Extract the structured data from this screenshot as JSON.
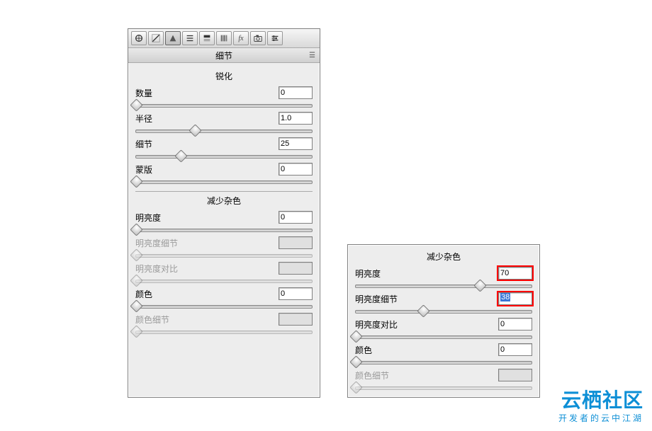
{
  "panel1": {
    "tab_label": "细节",
    "toolbar_icons": [
      "aperture",
      "adjust",
      "detail",
      "curves",
      "split",
      "hsl",
      "fx",
      "camera",
      "presets"
    ],
    "sharpen": {
      "title": "锐化",
      "rows": [
        {
          "label": "数量",
          "value": "0",
          "thumb": 0
        },
        {
          "label": "半径",
          "value": "1.0",
          "thumb": 33
        },
        {
          "label": "细节",
          "value": "25",
          "thumb": 25
        },
        {
          "label": "蒙版",
          "value": "0",
          "thumb": 0
        }
      ]
    },
    "noise": {
      "title": "减少杂色",
      "rows": [
        {
          "label": "明亮度",
          "value": "0",
          "thumb": 0,
          "disabled": false
        },
        {
          "label": "明亮度细节",
          "value": "",
          "thumb": 0,
          "disabled": true
        },
        {
          "label": "明亮度对比",
          "value": "",
          "thumb": 0,
          "disabled": true
        },
        {
          "label": "颜色",
          "value": "0",
          "thumb": 0,
          "disabled": false
        },
        {
          "label": "颜色细节",
          "value": "",
          "thumb": 0,
          "disabled": true
        }
      ]
    }
  },
  "panel2": {
    "title": "减少杂色",
    "rows": [
      {
        "label": "明亮度",
        "value": "70",
        "thumb": 70,
        "hl": true,
        "disabled": false
      },
      {
        "label": "明亮度细节",
        "value": "38",
        "thumb": 38,
        "hl": true,
        "sel": true,
        "disabled": false
      },
      {
        "label": "明亮度对比",
        "value": "0",
        "thumb": 0,
        "disabled": false
      },
      {
        "label": "颜色",
        "value": "0",
        "thumb": 0,
        "disabled": false
      },
      {
        "label": "颜色细节",
        "value": "",
        "thumb": 0,
        "disabled": true
      }
    ]
  },
  "branding": {
    "main": "云栖社区",
    "sub": "开发者的云中江湖"
  }
}
